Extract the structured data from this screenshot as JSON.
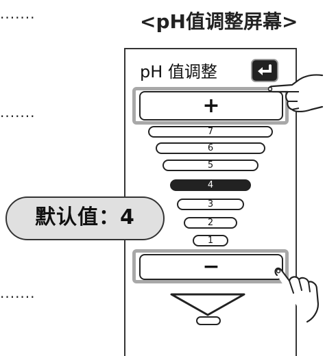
{
  "dots": [
    "·······",
    "·······",
    "·······"
  ],
  "screen_caption": "<pH值调整屏幕>",
  "panel": {
    "title": "pH 值调整",
    "enter_icon": "return-arrow-icon",
    "plus_label": "+",
    "minus_label": "−",
    "levels": [
      "7",
      "6",
      "5",
      "4",
      "3",
      "2",
      "1"
    ],
    "selected_level": "4",
    "scroll_icon": "down-triangle-icon"
  },
  "callout": {
    "default_label": "默认值：4"
  },
  "colors": {
    "highlight": "#a8a8a8",
    "active_level": "#222222",
    "pill": "#e0e0e0"
  }
}
